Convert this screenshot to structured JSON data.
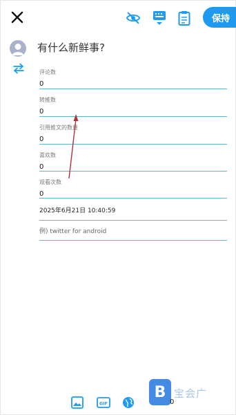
{
  "header": {
    "save_label": "保持"
  },
  "compose": {
    "placeholder": "有什么新鲜事?"
  },
  "fields": [
    {
      "label": "评论数",
      "value": "0"
    },
    {
      "label": "转推数",
      "value": "0"
    },
    {
      "label": "引用推文的数量",
      "value": "0"
    },
    {
      "label": "喜欢数",
      "value": "0"
    },
    {
      "label": "观看次数",
      "value": "0"
    }
  ],
  "date": {
    "value": "2025年6月21日 10:40:59"
  },
  "client": {
    "placeholder": "例) twitter for android"
  },
  "footer": {
    "gif_label": "GIF",
    "counter": "0"
  },
  "watermark": {
    "text": "宝会广"
  },
  "colors": {
    "accent": "#1d9bf0",
    "underline": "#5ab8c9",
    "annotation_arrow": "#b0303c"
  }
}
